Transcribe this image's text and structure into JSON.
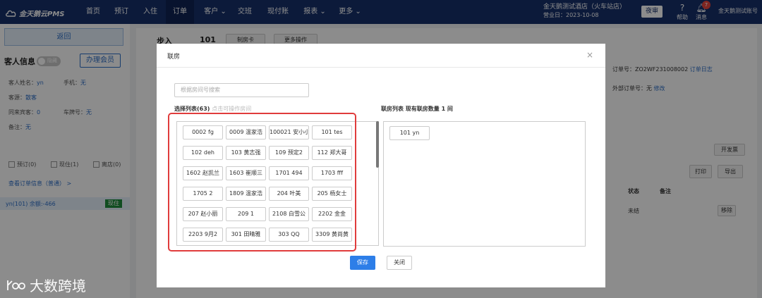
{
  "topnav": {
    "logo": "金天鹅云PMS",
    "items": [
      "首页",
      "预订",
      "入住",
      "订单",
      "客户",
      "交班",
      "现付账",
      "报表",
      "更多"
    ],
    "hotel_name": "金天鹅测试酒店（火车站店）",
    "business_date": "营业日：2023-10-08",
    "night_audit": "夜审",
    "help": "帮助",
    "messages": "消息",
    "message_count": "7",
    "account": "金天鹅测试账号"
  },
  "left": {
    "back": "返回",
    "guest_info": "客人信息",
    "toggle_label": "隐藏",
    "member_btn": "办理会员",
    "guest_name_label": "客人姓名：",
    "guest_name": "yn",
    "phone_label": "手机：",
    "phone": "无",
    "source_label": "客源：",
    "source": "散客",
    "companions_label": "同来宾客：",
    "companions": "0",
    "plate_label": "车牌号：",
    "plate": "无",
    "note_label": "备注：",
    "note": "无",
    "filters": [
      "预订(0)",
      "现住(1)",
      "离店(0)"
    ],
    "view_link": "查看订单信息（普通） >",
    "order_row": "yn(101)  余额:-466",
    "order_status": "现住"
  },
  "main": {
    "status": "步入",
    "room_no": "101",
    "card_btn": "制房卡",
    "more_btn": "更多操作",
    "order_no_label": "订单号：ZO2WF231008002",
    "order_log": "订单日志",
    "ext_order_label": "外部订单号：无",
    "modify": "修改",
    "invoice_btn": "开发票",
    "print_btn": "打印",
    "export_btn": "导出",
    "col_status": "状态",
    "col_note": "备注",
    "row_status": "未结",
    "remove_btn": "移除"
  },
  "dialog": {
    "title": "联房",
    "close": "×",
    "search_placeholder": "根据房间号搜索",
    "select_label": "选择列表(63)",
    "select_hint": "点击可操作房间",
    "linked_label": "联房列表 现有联房数量 1 间",
    "rooms": [
      "0002  fg",
      "0009  温家浩",
      "100021  安小小",
      "101  tes",
      "102  deh",
      "103  黄志强",
      "109  预定2",
      "112  郑大哥",
      "1602  赵凯兰",
      "1603  崔顺三",
      "1701  494",
      "1703  fff",
      "1705  2",
      "1809  温家浩",
      "204  叶美",
      "205  杨女士",
      "207  赵小丽",
      "209  1",
      "2108  白雪公",
      "2202  金金",
      "2203  9月2",
      "301  田晴雅",
      "303  QQ",
      "3309  黄尚黄"
    ],
    "linked_rooms": [
      "101  yn"
    ],
    "save": "保存",
    "cancel": "关闭"
  },
  "watermark": "大数跨境"
}
